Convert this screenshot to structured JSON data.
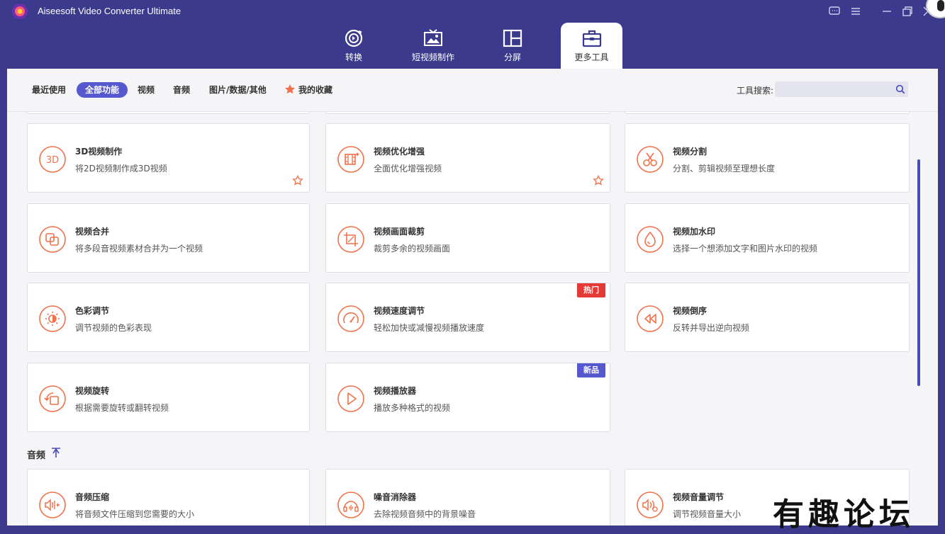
{
  "window": {
    "title": "Aiseesoft Video Converter Ultimate"
  },
  "main_tabs": [
    {
      "label": "转换",
      "icon": "convert-icon"
    },
    {
      "label": "短视频制作",
      "icon": "mv-icon"
    },
    {
      "label": "分屏",
      "icon": "collage-icon"
    },
    {
      "label": "更多工具",
      "icon": "toolbox-icon",
      "active": true
    }
  ],
  "filters": {
    "items": [
      "最近使用",
      "全部功能",
      "视频",
      "音频",
      "图片/数据/其他",
      "我的收藏"
    ],
    "active": "全部功能"
  },
  "search": {
    "label": "工具搜索:",
    "value": ""
  },
  "tools": [
    {
      "title": "3D视频制作",
      "desc": "将2D视频制作成3D视频",
      "icon": "3d-icon",
      "favorite_star": true
    },
    {
      "title": "视频优化增强",
      "desc": "全面优化增强视频",
      "icon": "enhance-icon",
      "favorite_star": true
    },
    {
      "title": "视频分割",
      "desc": "分割、剪辑视频至理想长度",
      "icon": "scissors-icon"
    },
    {
      "title": "视频合并",
      "desc": "将多段音视频素材合并为一个视频",
      "icon": "merge-icon"
    },
    {
      "title": "视频画面裁剪",
      "desc": "裁剪多余的视频画面",
      "icon": "crop-icon"
    },
    {
      "title": "视频加水印",
      "desc": "选择一个想添加文字和图片水印的视频",
      "icon": "watermark-drop-icon"
    },
    {
      "title": "色彩调节",
      "desc": "调节视频的色彩表现",
      "icon": "color-sun-icon"
    },
    {
      "title": "视频速度调节",
      "desc": "轻松加快或减慢视频播放速度",
      "icon": "speedometer-icon",
      "badge": "热门"
    },
    {
      "title": "视频倒序",
      "desc": "反转并导出逆向视频",
      "icon": "rewind-icon"
    },
    {
      "title": "视频旋转",
      "desc": "根据需要旋转或翻转视频",
      "icon": "rotate-icon"
    },
    {
      "title": "视频播放器",
      "desc": "播放多种格式的视频",
      "icon": "play-icon",
      "badge": "新品"
    }
  ],
  "audio_section": {
    "title": "音频"
  },
  "audio_tools": [
    {
      "title": "音频压缩",
      "desc": "将音频文件压缩到您需要的大小",
      "icon": "audio-compress-icon"
    },
    {
      "title": "噪音消除器",
      "desc": "去除视频音频中的背景噪音",
      "icon": "noise-remover-icon"
    },
    {
      "title": "视频音量调节",
      "desc": "调节视频音量大小",
      "icon": "volume-icon"
    }
  ],
  "watermark_text": "有趣论坛",
  "colors": {
    "accent": "#5658d0",
    "header": "#3b3a8c",
    "icon": "#f0714a",
    "hot": "#e53935"
  }
}
